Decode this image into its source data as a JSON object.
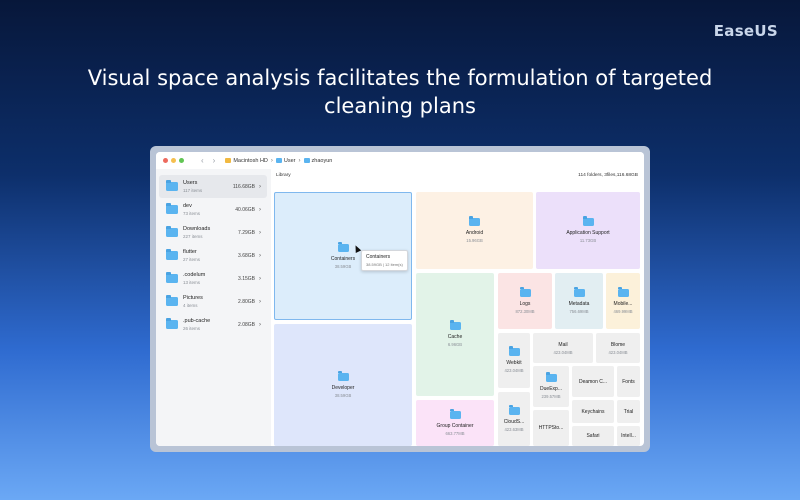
{
  "brand": {
    "logo_text": "EaseUS"
  },
  "headline": {
    "line1": "Visual space analysis facilitates the formulation of targeted",
    "line2": "cleaning plans"
  },
  "colors": {
    "accent": "#5ab4f0",
    "traffic_red": "#ed6a5e",
    "traffic_yellow": "#f5bf4f",
    "traffic_green": "#61c554"
  },
  "window": {
    "nav_back_icon": "chevron-left-icon",
    "nav_forward_icon": "chevron-right-icon",
    "breadcrumbs": [
      "Macintosh HD",
      "User",
      "zhaoyun"
    ]
  },
  "sidebar": {
    "items": [
      {
        "name": "Users",
        "count": "117 items",
        "size": "116.68GB"
      },
      {
        "name": "dev",
        "count": "73 items",
        "size": "40.06GB"
      },
      {
        "name": "Downloads",
        "count": "227 items",
        "size": "7.29GB"
      },
      {
        "name": "flutter",
        "count": "27 items",
        "size": "3.68GB"
      },
      {
        "name": ".codelum",
        "count": "13 items",
        "size": "3.15GB"
      },
      {
        "name": "Pictures",
        "count": "4 items",
        "size": "2.80GB"
      },
      {
        "name": ".pub-cache",
        "count": "26 items",
        "size": "2.08GB"
      }
    ]
  },
  "content": {
    "title": "Library",
    "summary": "114 folders, 3files,116.68GB",
    "tiles": {
      "containers": {
        "name": "Containers",
        "size": "38.59GB"
      },
      "developer": {
        "name": "Developer",
        "size": "38.59GB"
      },
      "android": {
        "name": "Android",
        "size": "15.96GB"
      },
      "app_support": {
        "name": "Application Support",
        "size": "11.73GB"
      },
      "cache": {
        "name": "Cache",
        "size": "6.96GB"
      },
      "logs": {
        "name": "Logs",
        "size": "872.30MB"
      },
      "metadata": {
        "name": "Metadata",
        "size": "756.69MB"
      },
      "mobile": {
        "name": "Mobile...",
        "size": "469.99MB"
      },
      "group_container": {
        "name": "Group Container",
        "size": "663.77MB"
      },
      "webkit": {
        "name": "Webkit",
        "size": "423.04MB"
      },
      "mail": {
        "name": "Mail",
        "size": "423.04MB"
      },
      "blome": {
        "name": "Blome",
        "size": "423.04MB"
      },
      "cloud": {
        "name": "CloudS...",
        "size": "423.63MB"
      },
      "duexp": {
        "name": "DueExp...",
        "size": "239.57MB"
      },
      "deamon": {
        "name": "Deamon C..."
      },
      "fonts": {
        "name": "Fonts"
      },
      "keychains": {
        "name": "Keychains"
      },
      "trial": {
        "name": "Trial"
      },
      "https": {
        "name": "HTTPSto..."
      },
      "safari": {
        "name": "Safari"
      },
      "intell": {
        "name": "Intell..."
      }
    },
    "tooltip": {
      "title": "Containers",
      "subtitle": "38.59GB | 12 item(s)"
    }
  }
}
